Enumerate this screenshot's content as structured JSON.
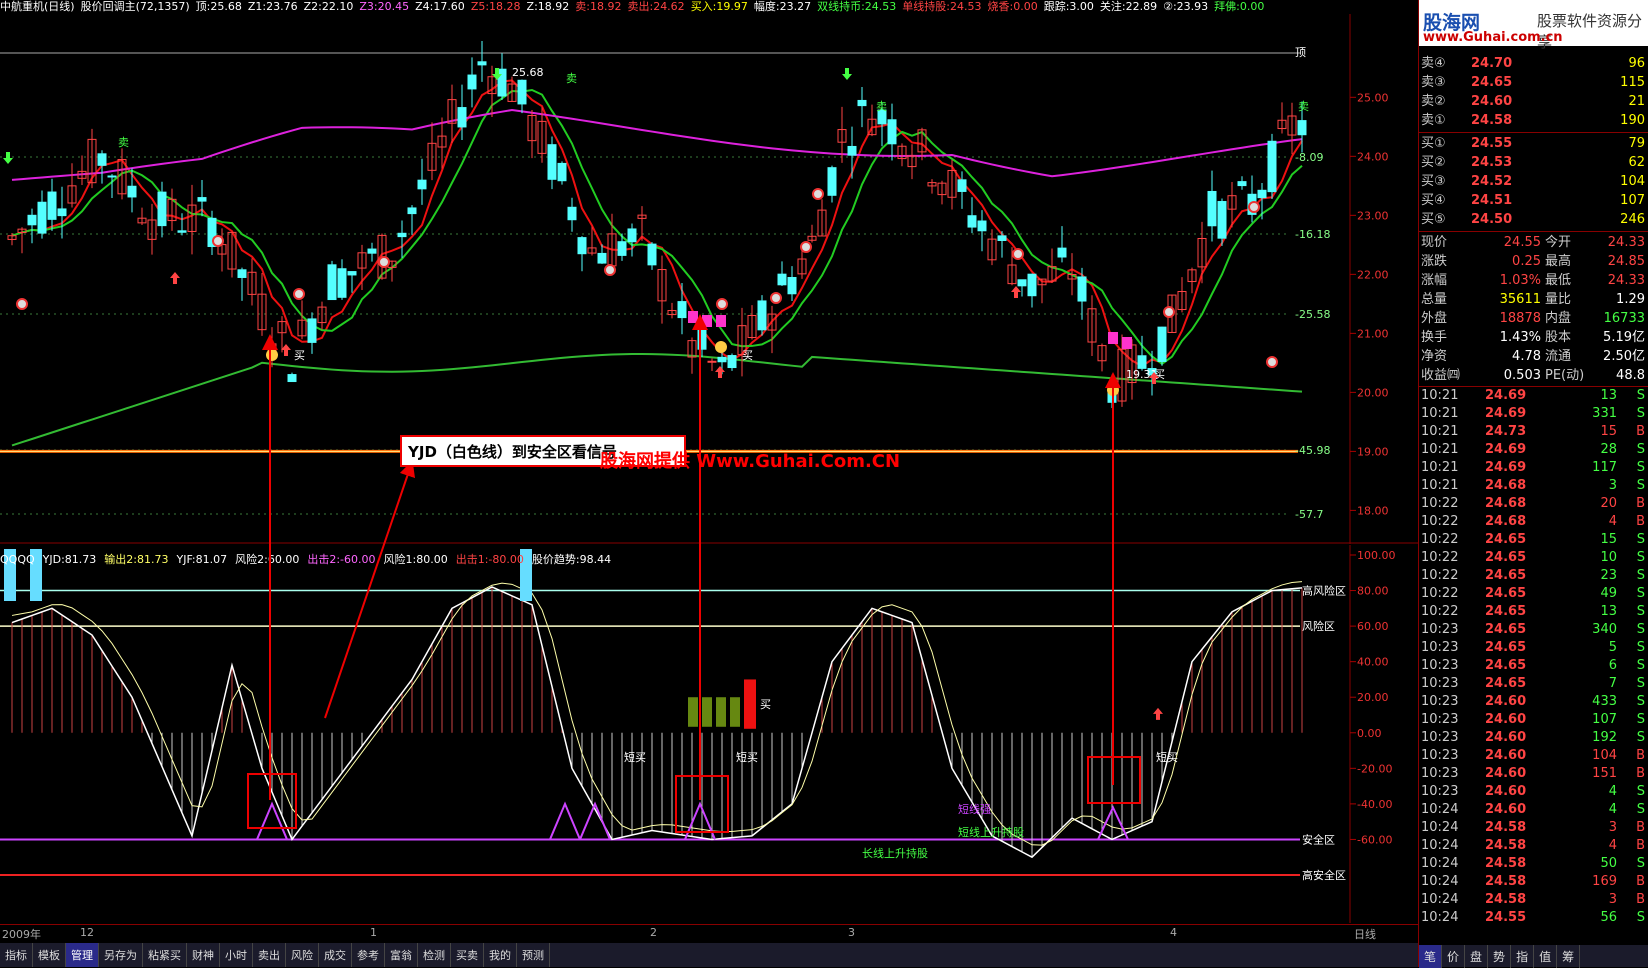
{
  "topbar": {
    "title": "中航重机(日线)",
    "indicator": "股价回调主(72,1357)",
    "items": [
      {
        "text": "顶:25.68",
        "color": "#ffffff"
      },
      {
        "text": "Z1:23.76",
        "color": "#ffffff"
      },
      {
        "text": "Z2:22.10",
        "color": "#ffffff"
      },
      {
        "text": "Z3:20.45",
        "color": "#ff66ff"
      },
      {
        "text": "Z4:17.60",
        "color": "#ffffff"
      },
      {
        "text": "Z5:18.28",
        "color": "#ff4444"
      },
      {
        "text": "Z:18.92",
        "color": "#ffffff"
      },
      {
        "text": "卖:18.92",
        "color": "#ff4444"
      },
      {
        "text": "卖出:24.62",
        "color": "#ff4444"
      },
      {
        "text": "买入:19.97",
        "color": "#ffff00"
      },
      {
        "text": "幅度:23.27",
        "color": "#ffffff"
      },
      {
        "text": "双线持币:24.53",
        "color": "#44ff44"
      },
      {
        "text": "单线持股:24.53",
        "color": "#ff4444"
      },
      {
        "text": "烧香:0.00",
        "color": "#ff4444"
      },
      {
        "text": "跟踪:3.00",
        "color": "#ffffff"
      },
      {
        "text": "关注:22.89",
        "color": "#ffffff"
      },
      {
        "text": "②:23.93",
        "color": "#ffffff"
      },
      {
        "text": "拜佛:0.00",
        "color": "#44ff44"
      }
    ]
  },
  "price_axis": {
    "labels": [
      "25.00",
      "24.00",
      "23.00",
      "22.00",
      "21.00",
      "20.00",
      "19.00",
      "18.00"
    ],
    "right_labels": [
      "顶",
      "-8.09",
      "-16.18",
      "-25.58",
      "-45.98",
      "-57.7"
    ]
  },
  "osc_axis": {
    "labels": [
      "100.00",
      "80.00",
      "60.00",
      "40.00",
      "20.00",
      "0.00",
      "-20.00",
      "-40.00",
      "-60.00"
    ],
    "zones": [
      "高风险区",
      "风险区",
      "安全区",
      "高安全区"
    ]
  },
  "osc_header": [
    {
      "text": "QQQQ",
      "color": "#ffffff"
    },
    {
      "text": "YJD:81.73",
      "color": "#ffffff"
    },
    {
      "text": "输出2:81.73",
      "color": "#ffff66"
    },
    {
      "text": "YJF:81.07",
      "color": "#ffffff"
    },
    {
      "text": "风险2:60.00",
      "color": "#ffffff"
    },
    {
      "text": "出击2:-60.00",
      "color": "#ff66ff"
    },
    {
      "text": "风险1:80.00",
      "color": "#ffffff"
    },
    {
      "text": "出击1:-80.00",
      "color": "#ff4444"
    },
    {
      "text": "股价趋势:98.44",
      "color": "#ffffff"
    }
  ],
  "annotations": {
    "note_box": "YJD（白色线）到安全区看信号",
    "watermark": "股海网提供 Www.Guhai.Com.CN",
    "buy": "买",
    "sell": "卖",
    "low_marker": "19.31",
    "short_buy": "短买",
    "short_strong": "短线强",
    "short_rise": "短线上升持股",
    "long_rise": "长线上升持股",
    "peak_price": "25.68"
  },
  "date_axis": [
    "2009年",
    "12",
    "1",
    "2",
    "3",
    "4"
  ],
  "date_axis_right": "日线",
  "bottom_tabs": [
    "指标",
    "模板",
    "管理",
    "另存为",
    "粘紧买",
    "财神",
    "小时",
    "卖出",
    "风险",
    "成交",
    "参考",
    "富翁",
    "检测",
    "买卖",
    "我的",
    "预测"
  ],
  "bottom_tabs_active": "管理",
  "logo": {
    "name": "股海网",
    "slogan": "股票软件资源分享",
    "url": "www.Guhai.com.cn"
  },
  "quote": {
    "asks": [
      {
        "label": "卖④",
        "price": "24.70",
        "vol": "96"
      },
      {
        "label": "卖③",
        "price": "24.65",
        "vol": "115"
      },
      {
        "label": "卖②",
        "price": "24.60",
        "vol": "21"
      },
      {
        "label": "卖①",
        "price": "24.58",
        "vol": "190"
      }
    ],
    "bids": [
      {
        "label": "买①",
        "price": "24.55",
        "vol": "79"
      },
      {
        "label": "买②",
        "price": "24.53",
        "vol": "62"
      },
      {
        "label": "买③",
        "price": "24.52",
        "vol": "104"
      },
      {
        "label": "买④",
        "price": "24.51",
        "vol": "107"
      },
      {
        "label": "买⑤",
        "price": "24.50",
        "vol": "246"
      }
    ],
    "stats": [
      {
        "l1": "现价",
        "v1": "24.55",
        "c1": "#ff4444",
        "l2": "今开",
        "v2": "24.33",
        "c2": "#ff4444"
      },
      {
        "l1": "涨跌",
        "v1": "0.25",
        "c1": "#ff4444",
        "l2": "最高",
        "v2": "24.85",
        "c2": "#ff4444"
      },
      {
        "l1": "涨幅",
        "v1": "1.03%",
        "c1": "#ff4444",
        "l2": "最低",
        "v2": "24.33",
        "c2": "#ff4444"
      },
      {
        "l1": "总量",
        "v1": "35611",
        "c1": "#ffff00",
        "l2": "量比",
        "v2": "1.29",
        "c2": "#ffffff"
      },
      {
        "l1": "外盘",
        "v1": "18878",
        "c1": "#ff4444",
        "l2": "内盘",
        "v2": "16733",
        "c2": "#44ff44"
      },
      {
        "l1": "换手",
        "v1": "1.43%",
        "c1": "#ffffff",
        "l2": "股本",
        "v2": "5.19亿",
        "c2": "#ffffff"
      },
      {
        "l1": "净资",
        "v1": "4.78",
        "c1": "#ffffff",
        "l2": "流通",
        "v2": "2.50亿",
        "c2": "#ffffff"
      },
      {
        "l1": "收益㈣",
        "v1": "0.503",
        "c1": "#ffffff",
        "l2": "PE(动)",
        "v2": "48.8",
        "c2": "#ffffff"
      }
    ],
    "ticks": [
      {
        "t": "10:21",
        "p": "24.69",
        "v": "13",
        "bs": "S"
      },
      {
        "t": "10:21",
        "p": "24.69",
        "v": "331",
        "bs": "S"
      },
      {
        "t": "10:21",
        "p": "24.73",
        "v": "15",
        "bs": "B"
      },
      {
        "t": "10:21",
        "p": "24.69",
        "v": "28",
        "bs": "S"
      },
      {
        "t": "10:21",
        "p": "24.69",
        "v": "117",
        "bs": "S"
      },
      {
        "t": "10:21",
        "p": "24.68",
        "v": "3",
        "bs": "S"
      },
      {
        "t": "10:22",
        "p": "24.68",
        "v": "20",
        "bs": "B"
      },
      {
        "t": "10:22",
        "p": "24.68",
        "v": "4",
        "bs": "B"
      },
      {
        "t": "10:22",
        "p": "24.65",
        "v": "15",
        "bs": "S"
      },
      {
        "t": "10:22",
        "p": "24.65",
        "v": "10",
        "bs": "S"
      },
      {
        "t": "10:22",
        "p": "24.65",
        "v": "23",
        "bs": "S"
      },
      {
        "t": "10:22",
        "p": "24.65",
        "v": "49",
        "bs": "S"
      },
      {
        "t": "10:22",
        "p": "24.65",
        "v": "13",
        "bs": "S"
      },
      {
        "t": "10:23",
        "p": "24.65",
        "v": "340",
        "bs": "S"
      },
      {
        "t": "10:23",
        "p": "24.65",
        "v": "5",
        "bs": "S"
      },
      {
        "t": "10:23",
        "p": "24.65",
        "v": "6",
        "bs": "S"
      },
      {
        "t": "10:23",
        "p": "24.65",
        "v": "7",
        "bs": "S"
      },
      {
        "t": "10:23",
        "p": "24.60",
        "v": "433",
        "bs": "S"
      },
      {
        "t": "10:23",
        "p": "24.60",
        "v": "107",
        "bs": "S"
      },
      {
        "t": "10:23",
        "p": "24.60",
        "v": "192",
        "bs": "S"
      },
      {
        "t": "10:23",
        "p": "24.60",
        "v": "104",
        "bs": "B"
      },
      {
        "t": "10:23",
        "p": "24.60",
        "v": "151",
        "bs": "B"
      },
      {
        "t": "10:23",
        "p": "24.60",
        "v": "4",
        "bs": "S"
      },
      {
        "t": "10:24",
        "p": "24.60",
        "v": "4",
        "bs": "S"
      },
      {
        "t": "10:24",
        "p": "24.58",
        "v": "3",
        "bs": "B"
      },
      {
        "t": "10:24",
        "p": "24.58",
        "v": "4",
        "bs": "B"
      },
      {
        "t": "10:24",
        "p": "24.58",
        "v": "50",
        "bs": "S"
      },
      {
        "t": "10:24",
        "p": "24.58",
        "v": "169",
        "bs": "B"
      },
      {
        "t": "10:24",
        "p": "24.58",
        "v": "3",
        "bs": "B"
      },
      {
        "t": "10:24",
        "p": "24.55",
        "v": "56",
        "bs": "S"
      }
    ]
  },
  "side_tabs": [
    "笔",
    "价",
    "盘",
    "势",
    "指",
    "值",
    "筹"
  ],
  "side_tabs_active": "笔",
  "colors": {
    "up": "#ff4444",
    "down": "#54ffff",
    "ma_red": "#ee1111",
    "ma_green": "#22cc22",
    "ma_magenta": "#dd22dd",
    "long_green": "#33bb33"
  }
}
